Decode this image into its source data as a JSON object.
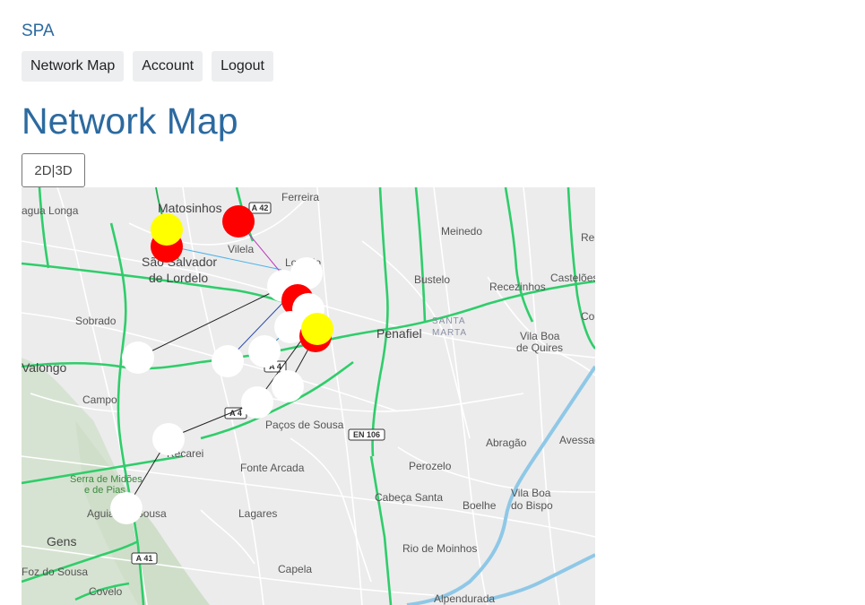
{
  "brand": {
    "label": "SPA"
  },
  "nav": {
    "items": [
      {
        "label": "Network Map"
      },
      {
        "label": "Account"
      },
      {
        "label": "Logout"
      }
    ]
  },
  "page": {
    "title": "Network Map"
  },
  "view_toggle": {
    "label": "2D|3D"
  },
  "colors": {
    "accent": "#2c6aa0",
    "node_red": "#ff0000",
    "node_yellow": "#ffff00",
    "node_white": "#ffffff",
    "road_green": "#2fcd6a"
  },
  "map": {
    "place_labels": [
      "Matosinhos",
      "Ferreira",
      "Meinedo",
      "Rea",
      "agua Longa",
      "Vilela",
      "São Salvador",
      "de Lordelo",
      "Lordelo",
      "Bustelo",
      "Recezinhos",
      "Castelões",
      "Sobrado",
      "SANTA",
      "MARTA",
      "Penafiel",
      "Vila Boa",
      "de Quires",
      "Col",
      "Valongo",
      "Campo",
      "Paços de Sousa",
      "Abragão",
      "Avessad",
      "Serra de Midões",
      "e de Pias",
      "Recarei",
      "Fonte Arcada",
      "Perozelo",
      "Cabeça Santa",
      "Boelhe",
      "Vila Boa",
      "do Bispo",
      "Aguiar de Sousa",
      "Lagares",
      "Gens",
      "Rio de Moinhos",
      "Foz do Sousa",
      "Capela",
      "Covelo",
      "Alpendurada",
      "Ferreira"
    ],
    "road_shields": [
      "A 42",
      "A 4",
      "A 4",
      "EN 106",
      "A 41"
    ]
  }
}
